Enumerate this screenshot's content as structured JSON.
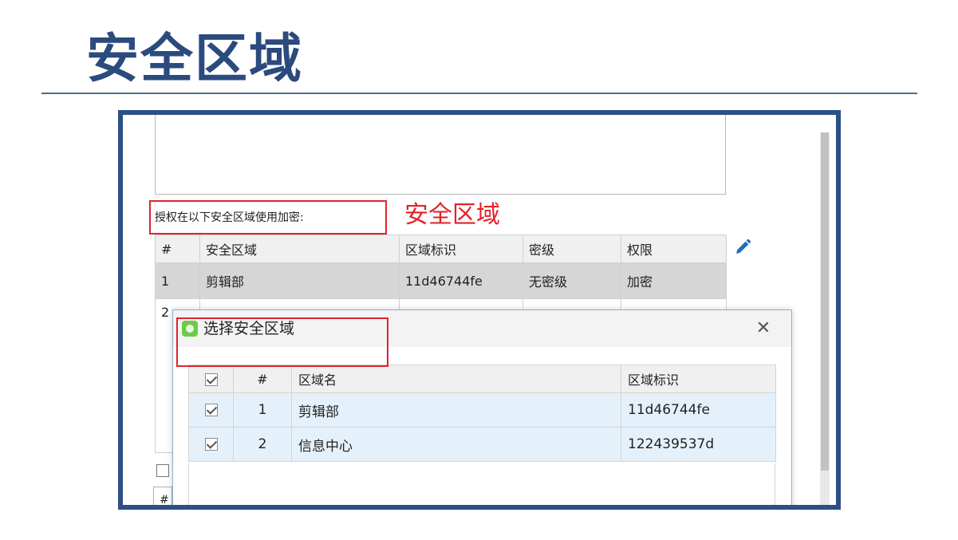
{
  "slide": {
    "title": "安全区域"
  },
  "screenshot": {
    "auth_label": "授权在以下安全区域使用加密:",
    "annotation": "安全区域",
    "bg_table": {
      "headers": [
        "#",
        "安全区域",
        "区域标识",
        "密级",
        "权限"
      ],
      "rows": [
        [
          "1",
          "剪辑部",
          "11d46744fe",
          "无密级",
          "加密"
        ],
        [
          "2",
          "",
          "",
          "",
          ""
        ]
      ]
    },
    "bg_hash_partial": "#",
    "dialog": {
      "title": "选择安全区域",
      "close_glyph": "✕",
      "headers": [
        "",
        "#",
        "区域名",
        "区域标识"
      ],
      "rows": [
        {
          "checked": true,
          "num": "1",
          "name": "剪辑部",
          "id": "11d46744fe"
        },
        {
          "checked": true,
          "num": "2",
          "name": "信息中心",
          "id": "122439537d"
        }
      ]
    },
    "colors": {
      "frame": "#2c4f86",
      "title": "#2b4a7d",
      "annotation_red": "#e0222a",
      "pencil_blue": "#1e6fc1",
      "selected_row": "#e5f1fa"
    },
    "icons": [
      "pencil-edit-icon",
      "app-icon",
      "close-icon",
      "checkbox-icon"
    ]
  }
}
